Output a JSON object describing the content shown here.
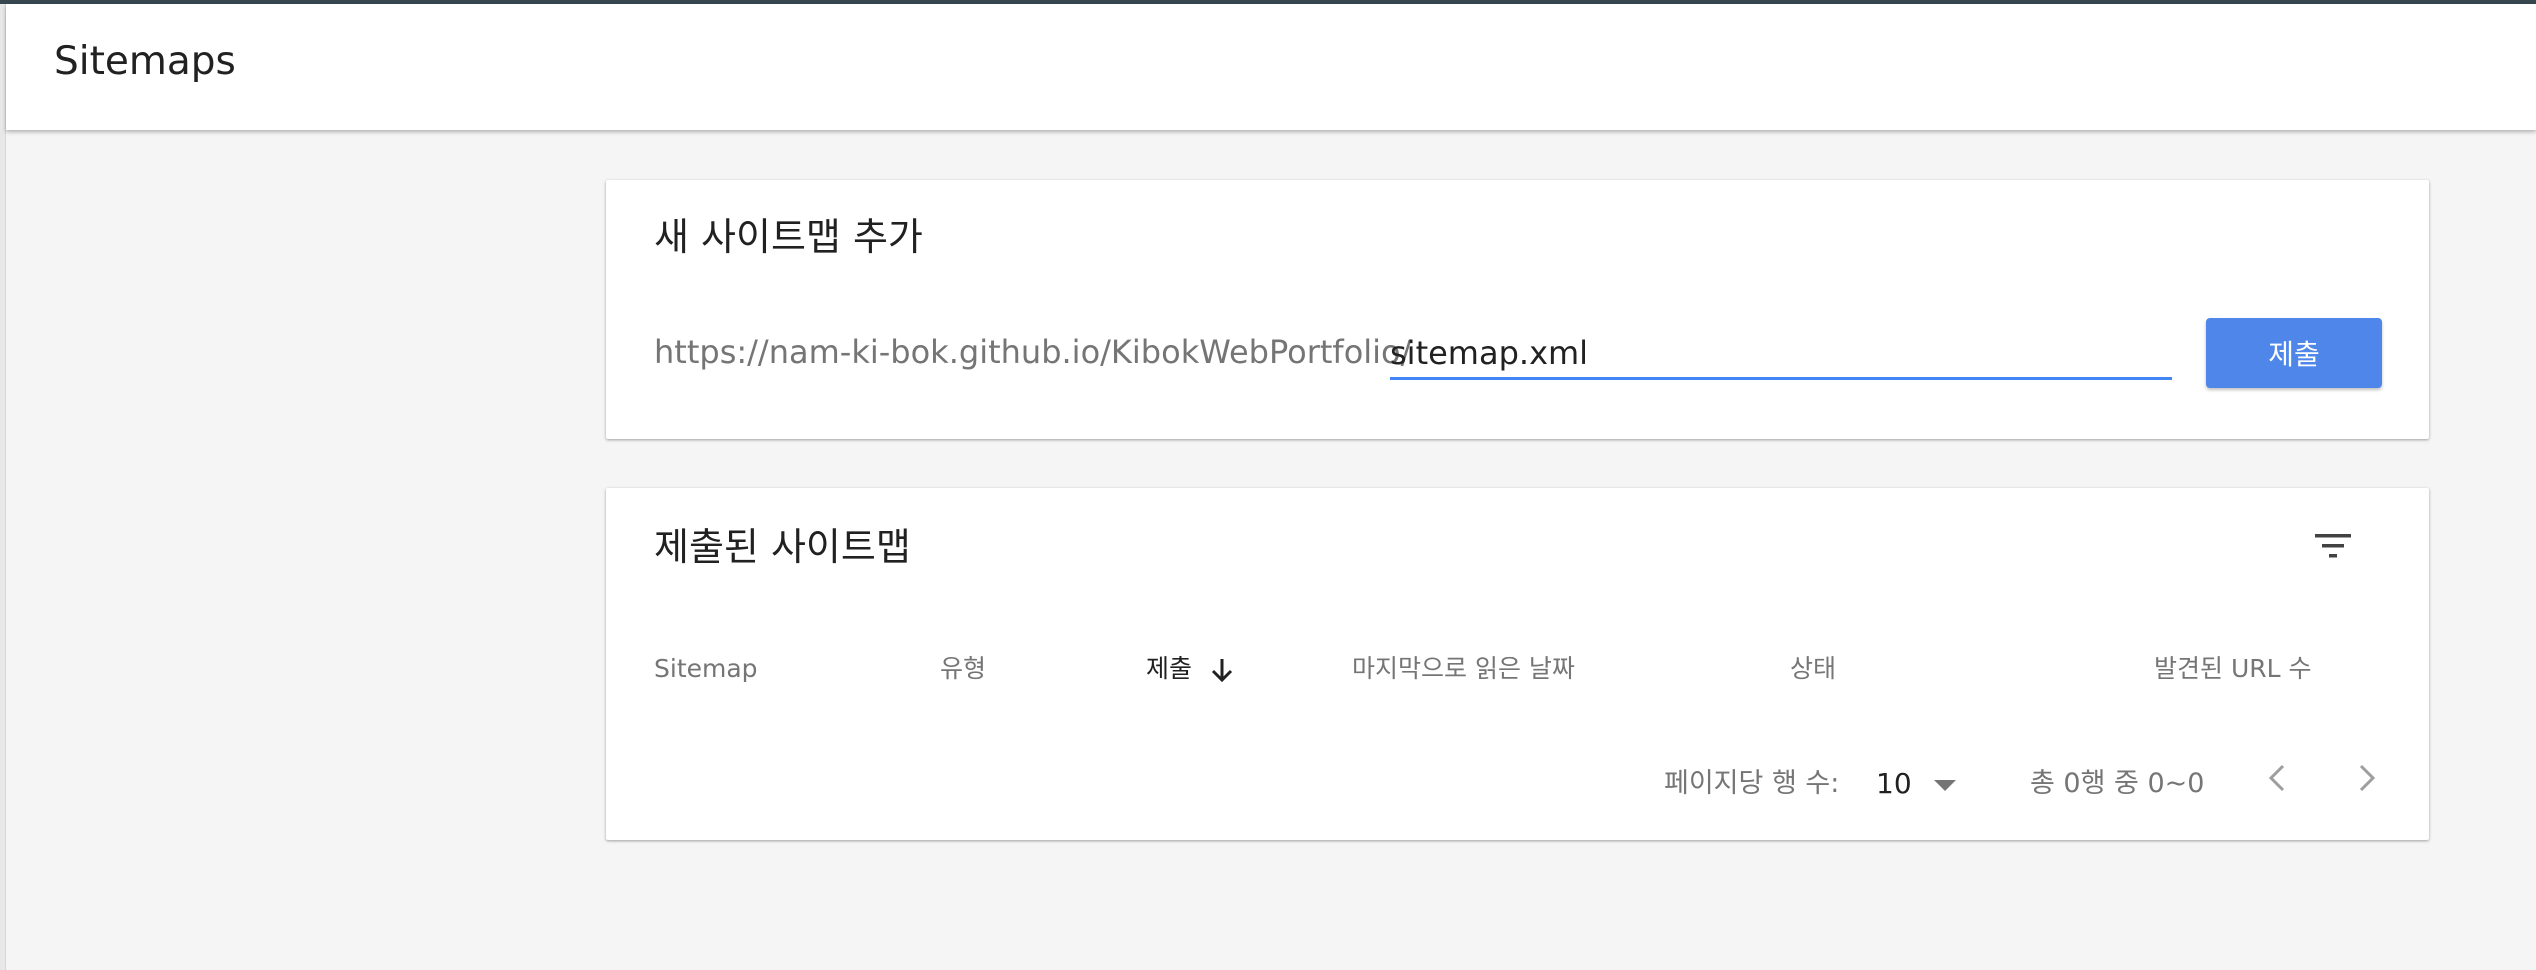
{
  "header": {
    "title": "Sitemaps"
  },
  "add_sitemap": {
    "title": "새 사이트맵 추가",
    "url_prefix": "https://nam-ki-bok.github.io/KibokWebPortfolio/",
    "input_value": "sitemap.xml",
    "submit_label": "제출",
    "accent_color": "#4285f4"
  },
  "submitted": {
    "title": "제출된 사이트맵",
    "filter_icon": "filter-list-icon",
    "columns": {
      "sitemap": "Sitemap",
      "type": "유형",
      "submitted": "제출",
      "last_read": "마지막으로 읽은 날짜",
      "status": "상태",
      "urls_found": "발견된 URL 수"
    },
    "sort_icon": "arrow-down-icon",
    "rows": [],
    "pager": {
      "rows_label": "페이지당 행 수:",
      "rows_value": "10",
      "range": "총 0행 중 0~0",
      "prev_icon": "chevron-left-icon",
      "next_icon": "chevron-right-icon"
    }
  }
}
